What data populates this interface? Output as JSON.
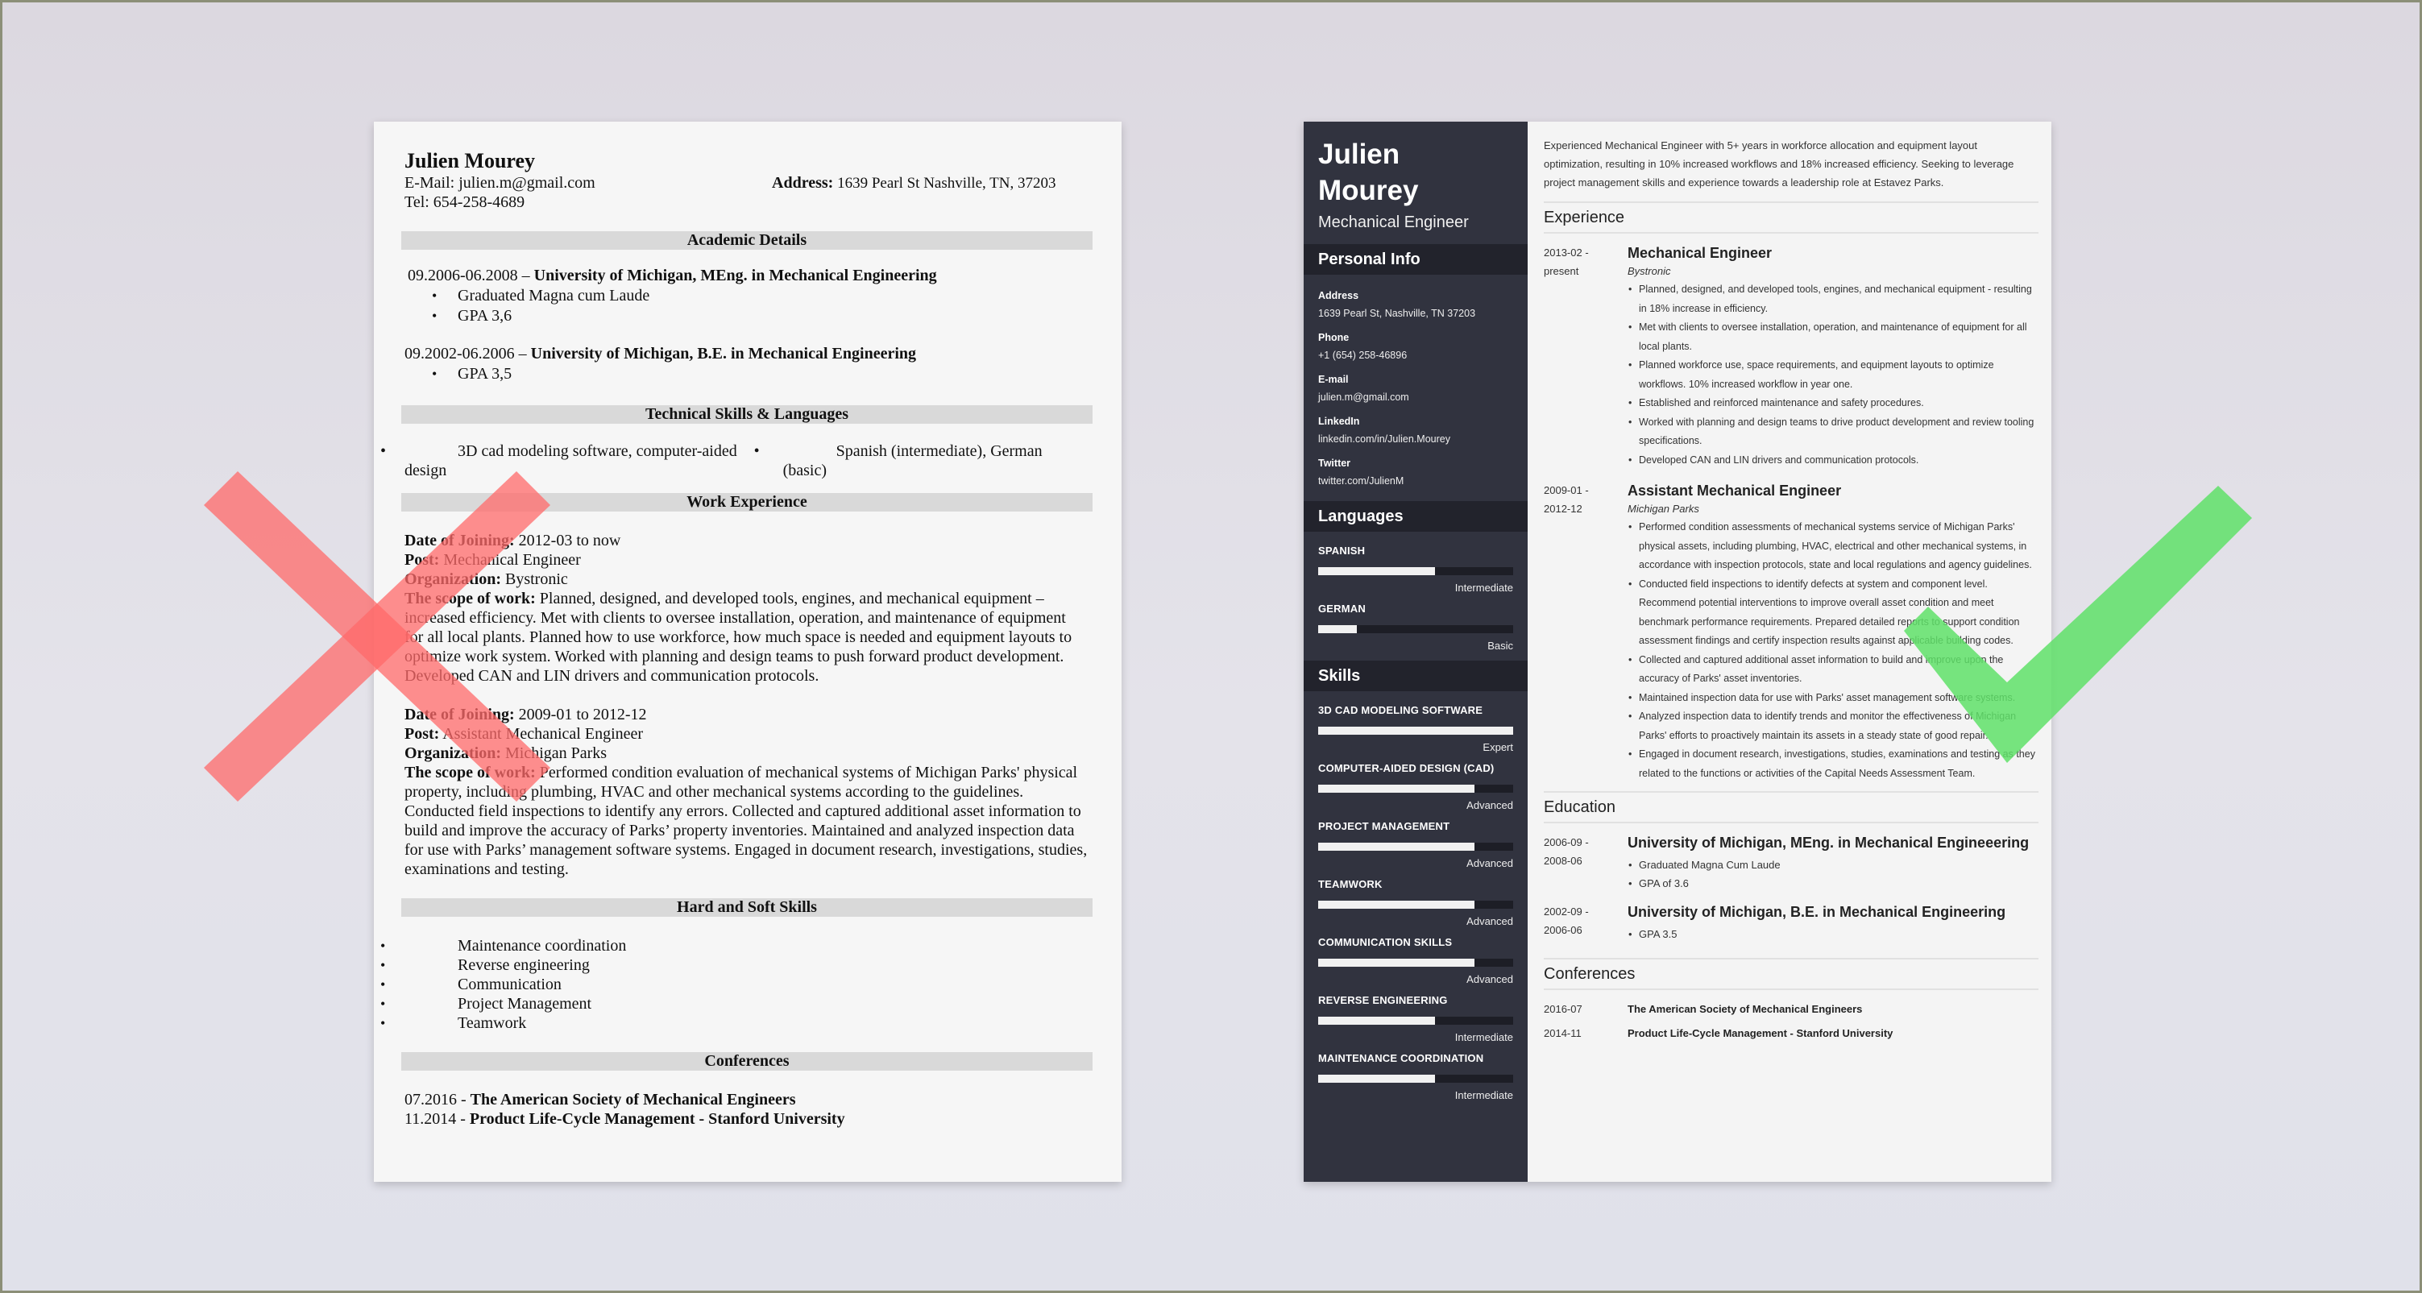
{
  "colors": {
    "bad_mark": "#ff7a7a",
    "good_mark": "#66e070",
    "sidebar_bg": "#31333f",
    "sidebar_header_bg": "#22232c",
    "section_band": "#d9d9d9"
  },
  "marks": {
    "bad_icon": "x-cross-icon",
    "good_icon": "checkmark-icon"
  },
  "left_resume": {
    "name": "Julien Mourey",
    "email_line": "E-Mail: julien.m@gmail.com",
    "tel_line": "Tel: 654-258-4689",
    "address_label": "Address:",
    "address_value": " 1639 Pearl St Nashville, TN, 37203",
    "sections": {
      "academic": "Academic Details",
      "tech": "Technical Skills & Languages",
      "work": "Work Experience",
      "skills": "Hard and Soft Skills",
      "conferences": "Conferences"
    },
    "education": [
      {
        "dates": "09.2006-06.2008 – ",
        "title": "University of Michigan, MEng. in Mechanical Engineering",
        "bullets": [
          "Graduated Magna cum Laude",
          "GPA 3,6"
        ]
      },
      {
        "dates": "09.2002-06.2006 – ",
        "title": "University of Michigan, B.E. in Mechanical Engineering",
        "bullets": [
          "GPA 3,5"
        ]
      }
    ],
    "tech_skills": [
      "3D cad modeling software, computer-aided design",
      "Spanish (intermediate), German (basic)"
    ],
    "jobs": [
      {
        "date_label": "Date of Joining:",
        "date_value": " 2012-03 to now",
        "post_label": "Post:",
        "post_value": " Mechanical Engineer",
        "org_label": "Organization:",
        "org_value": " Bystronic",
        "scope_label": "The scope of work:",
        "scope_value": " Planned, designed, and developed tools, engines, and mechanical equipment – increased efficiency. Met with clients to oversee installation, operation, and maintenance of equipment for all local plants. Planned how to use workforce, how much space is needed and equipment layouts to optimize work system. Worked with planning and design teams to push forward product development. Developed CAN and LIN drivers and communication protocols."
      },
      {
        "date_label": "Date of Joining:",
        "date_value": " 2009-01 to 2012-12",
        "post_label": "Post:",
        "post_value": " Assistant Mechanical Engineer",
        "org_label": "Organization:",
        "org_value": " Michigan Parks",
        "scope_label": "The scope of work:",
        "scope_value": " Performed condition evaluation of mechanical systems of Michigan Parks' physical property, including plumbing, HVAC and other mechanical systems according to the guidelines. Conducted field inspections to identify any errors. Collected and captured additional asset information to build and improve the accuracy of Parks’ property inventories. Maintained and analyzed inspection data for use with Parks’ management software systems. Engaged in document research, investigations, studies, examinations and testing."
      }
    ],
    "skills": [
      "Maintenance coordination",
      "Reverse engineering",
      "Communication",
      "Project Management",
      "Teamwork"
    ],
    "conferences": [
      {
        "date": "07.2016 - ",
        "title": "The American Society of Mechanical Engineers"
      },
      {
        "date": "11.2014 -  ",
        "title": "Product Life-Cycle Management - Stanford University"
      }
    ]
  },
  "right_resume": {
    "first_name": "Julien",
    "last_name": "Mourey",
    "job_title": "Mechanical Engineer",
    "personal_info_heading": "Personal Info",
    "personal_info": [
      {
        "label": "Address",
        "value": "1639 Pearl St, Nashville, TN 37203"
      },
      {
        "label": "Phone",
        "value": "+1 (654) 258-46896"
      },
      {
        "label": "E-mail",
        "value": "julien.m@gmail.com"
      },
      {
        "label": "LinkedIn",
        "value": "linkedin.com/in/Julien.Mourey"
      },
      {
        "label": "Twitter",
        "value": "twitter.com/JulienM"
      }
    ],
    "languages_heading": "Languages",
    "languages": [
      {
        "name": "SPANISH",
        "level": "Intermediate",
        "fill": 0.6
      },
      {
        "name": "GERMAN",
        "level": "Basic",
        "fill": 0.2
      }
    ],
    "skills_heading": "Skills",
    "skills": [
      {
        "name": "3D CAD MODELING SOFTWARE",
        "level": "Expert",
        "fill": 1.0
      },
      {
        "name": "COMPUTER-AIDED DESIGN (CAD)",
        "level": "Advanced",
        "fill": 0.8
      },
      {
        "name": "PROJECT MANAGEMENT",
        "level": "Advanced",
        "fill": 0.8
      },
      {
        "name": "TEAMWORK",
        "level": "Advanced",
        "fill": 0.8
      },
      {
        "name": "COMMUNICATION SKILLS",
        "level": "Advanced",
        "fill": 0.8
      },
      {
        "name": "REVERSE ENGINEERING",
        "level": "Intermediate",
        "fill": 0.6
      },
      {
        "name": "MAINTENANCE COORDINATION",
        "level": "Intermediate",
        "fill": 0.6
      }
    ],
    "summary": "Experienced Mechanical Engineer with 5+ years in workforce allocation and equipment layout optimization, resulting in 10% increased workflows and 18% increased efficiency. Seeking to leverage project management skills and experience towards a leadership role at Estavez Parks.",
    "experience_heading": "Experience",
    "jobs": [
      {
        "date_start": "2013-02 -",
        "date_end": "present",
        "title": "Mechanical Engineer",
        "org": "Bystronic",
        "bullets": [
          "Planned, designed, and developed tools, engines, and mechanical equipment - resulting in 18% increase in efficiency.",
          "Met with clients to oversee installation, operation, and maintenance of equipment for all local plants.",
          "Planned workforce use, space requirements, and equipment layouts to optimize workflows. 10% increased workflow in year one.",
          "Established and reinforced maintenance and safety procedures.",
          "Worked with planning and design teams to drive product development and review tooling specifications.",
          "Developed CAN and LIN drivers and communication protocols."
        ]
      },
      {
        "date_start": "2009-01 -",
        "date_end": "2012-12",
        "title": "Assistant Mechanical Engineer",
        "org": "Michigan Parks",
        "bullets": [
          "Performed condition assessments of mechanical systems service of Michigan Parks' physical assets, including plumbing, HVAC, electrical and other mechanical systems, in accordance with inspection protocols, state and local regulations and agency guidelines.",
          "Conducted field inspections to identify defects at system and component level. Recommend potential interventions to improve overall asset condition and meet benchmark performance requirements. Prepared detailed reports to support condition assessment findings and certify inspection results against applicable building codes.",
          "Collected and captured additional asset information to build and improve upon the accuracy of Parks' asset inventories.",
          "Maintained inspection data for use with Parks' asset management software systems.",
          "Analyzed inspection data to identify trends and monitor the effectiveness of Michigan Parks' efforts to proactively maintain its assets in a steady state of good repair.",
          "Engaged in document research, investigations, studies, examinations and testing as they related to the functions or activities of the Capital Needs Assessment Team."
        ]
      }
    ],
    "education_heading": "Education",
    "education": [
      {
        "date_start": "2006-09 -",
        "date_end": "2008-06",
        "title": "University of Michigan, MEng. in Mechanical Engineeering",
        "bullets": [
          "Graduated Magna Cum Laude",
          "GPA of 3.6"
        ]
      },
      {
        "date_start": "2002-09 -",
        "date_end": "2006-06",
        "title": "University of Michigan, B.E. in Mechanical Engineering",
        "bullets": [
          "GPA 3.5"
        ]
      }
    ],
    "conferences_heading": "Conferences",
    "conferences": [
      {
        "date": "2016-07",
        "title": "The American Society of Mechanical Engineers"
      },
      {
        "date": "2014-11",
        "title": "Product Life-Cycle Management - Stanford University"
      }
    ]
  }
}
